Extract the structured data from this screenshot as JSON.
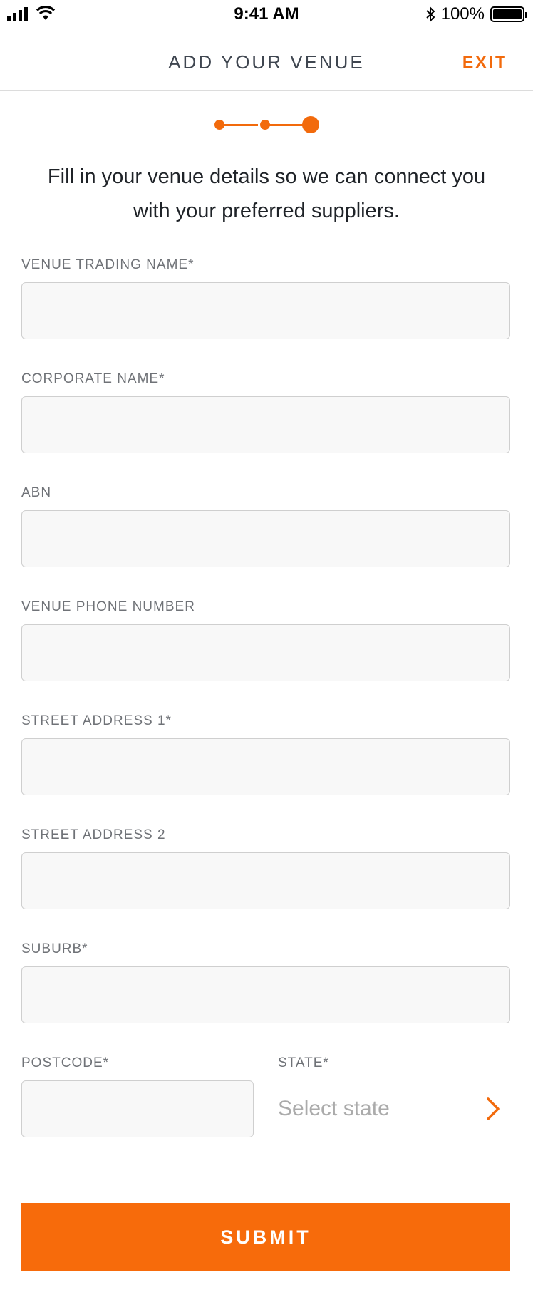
{
  "status_bar": {
    "time": "9:41 AM",
    "battery": "100%"
  },
  "header": {
    "title": "ADD YOUR VENUE",
    "exit_label": "EXIT"
  },
  "intro_text": "Fill in your venue details so we can connect you with your preferred suppliers.",
  "form": {
    "venue_trading_name": {
      "label": "VENUE TRADING NAME*",
      "value": ""
    },
    "corporate_name": {
      "label": "CORPORATE NAME*",
      "value": ""
    },
    "abn": {
      "label": "ABN",
      "value": ""
    },
    "venue_phone_number": {
      "label": "VENUE PHONE NUMBER",
      "value": ""
    },
    "street_address_1": {
      "label": "STREET ADDRESS 1*",
      "value": ""
    },
    "street_address_2": {
      "label": "STREET ADDRESS 2",
      "value": ""
    },
    "suburb": {
      "label": "SUBURB*",
      "value": ""
    },
    "postcode": {
      "label": "POSTCODE*",
      "value": ""
    },
    "state": {
      "label": "STATE*",
      "placeholder": "Select state"
    }
  },
  "submit_label": "SUBMIT",
  "colors": {
    "accent": "#f26a0c",
    "submit_bg": "#f76b0b",
    "field_bg": "#f8f8f8"
  }
}
